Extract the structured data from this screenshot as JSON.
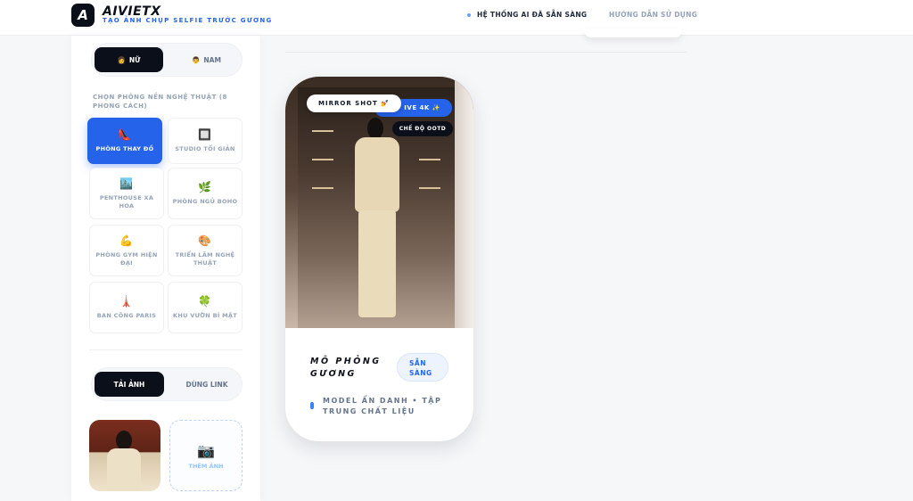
{
  "header": {
    "logo_letter": "A",
    "brand": "AIVIETX",
    "tagline": "TẠO ẢNH CHỤP SELFIE TRƯỚC GƯƠNG",
    "status_text": "HỆ THỐNG AI ĐÃ SẴN SÀNG",
    "guide_text": "HƯỚNG DẪN SỬ DỤNG"
  },
  "sidebar": {
    "gender": [
      {
        "label": "NỮ",
        "icon": "👩",
        "active": true
      },
      {
        "label": "NAM",
        "icon": "👨",
        "active": false
      }
    ],
    "bg_label": "CHỌN PHÔNG NỀN NGHỆ THUẬT (8 PHONG CÁCH)",
    "rooms": [
      {
        "label": "PHÒNG THAY ĐỒ",
        "icon": "👠",
        "active": true
      },
      {
        "label": "STUDIO TỐI GIẢN",
        "icon": "🔲",
        "active": false
      },
      {
        "label": "PENTHOUSE XA HOA",
        "icon": "🏙️",
        "active": false
      },
      {
        "label": "PHÒNG NGỦ BOHO",
        "icon": "🌿",
        "active": false
      },
      {
        "label": "PHÒNG GYM HIỆN ĐẠI",
        "icon": "💪",
        "active": false
      },
      {
        "label": "TRIỂN LÃM NGHỆ THUẬT",
        "icon": "🎨",
        "active": false
      },
      {
        "label": "BAN CÔNG PARIS",
        "icon": "🗼",
        "active": false
      },
      {
        "label": "KHU VƯỜN BÍ MẬT",
        "icon": "🍀",
        "active": false
      }
    ],
    "upload_tabs": [
      {
        "label": "TẢI ẢNH",
        "active": true
      },
      {
        "label": "DÙNG LINK",
        "active": false
      }
    ],
    "add_photo_label": "THÊM ẢNH",
    "add_photo_icon": "📷"
  },
  "preview": {
    "pill_mirror": "MIRROR SHOT 💅",
    "pill_4k": "IVE 4K ✨",
    "pill_ootd": "CHẾ ĐỘ OOTD",
    "title": "MÔ PHỎNG GƯƠNG",
    "badge": "SẴN SÀNG",
    "subtitle": "MODEL ẨN DANH • TẬP TRUNG CHẤT LIỆU"
  }
}
